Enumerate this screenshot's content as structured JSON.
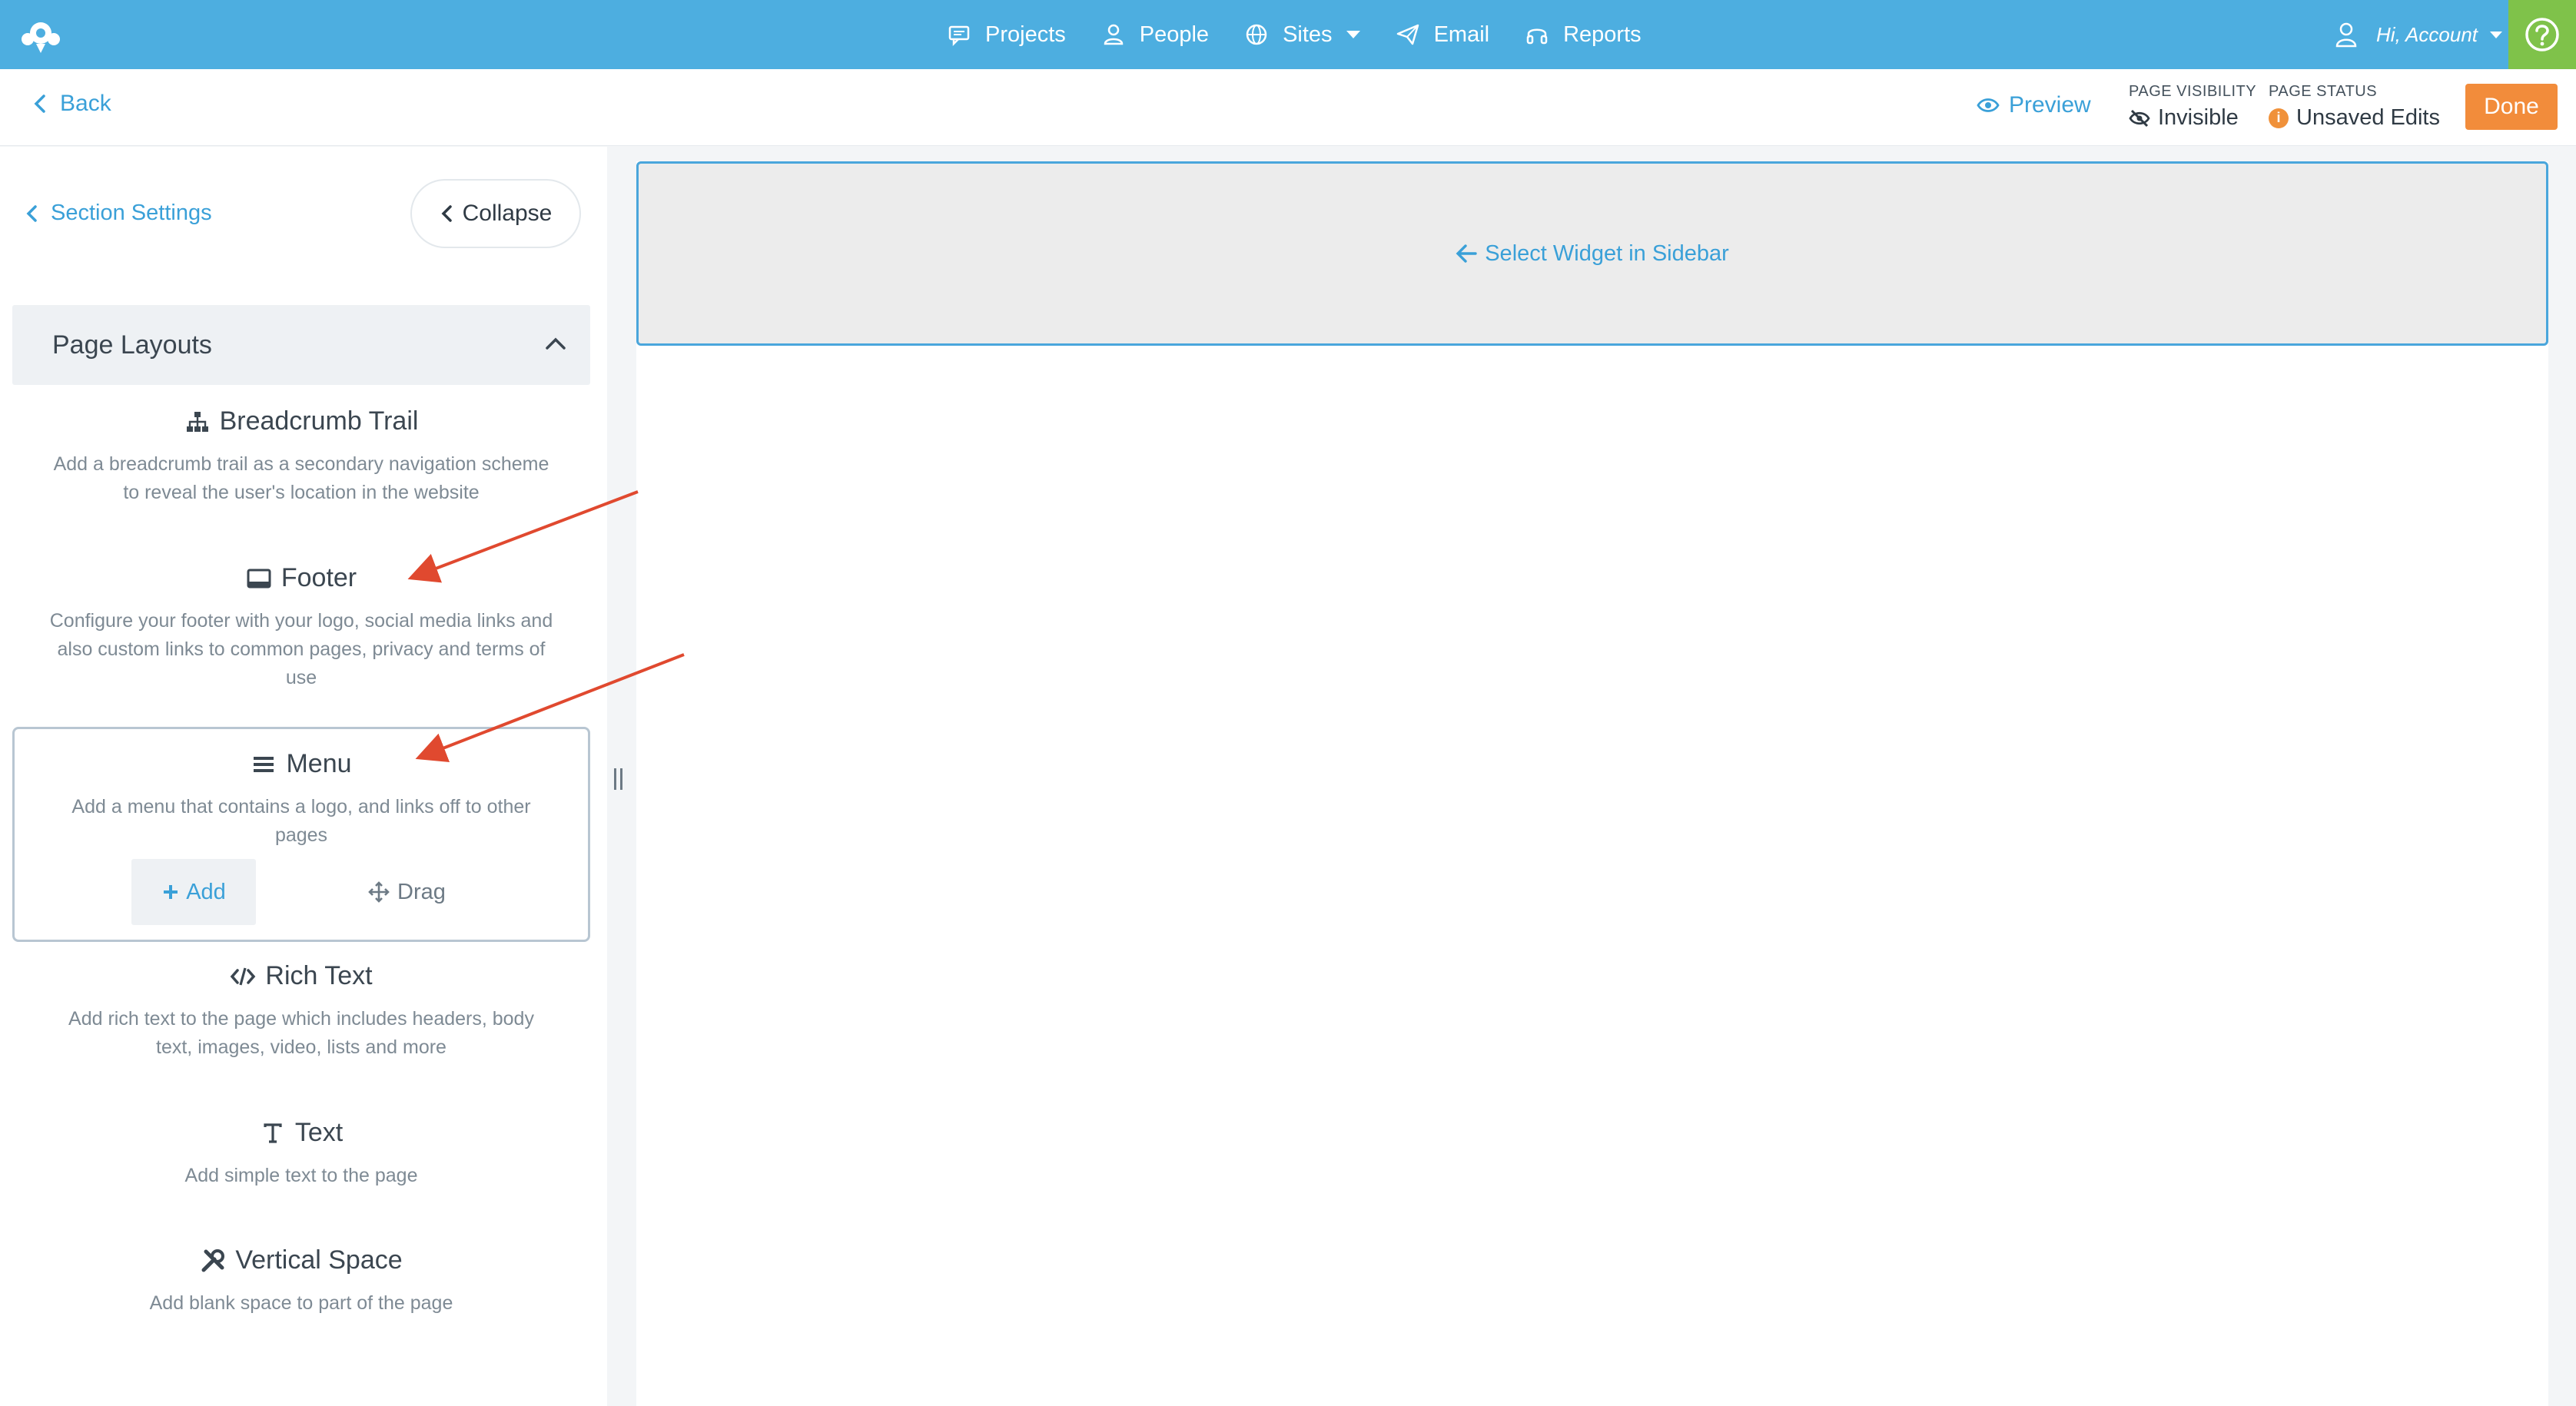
{
  "nav": {
    "items": [
      {
        "label": "Projects",
        "icon": "chat-icon"
      },
      {
        "label": "People",
        "icon": "user-icon"
      },
      {
        "label": "Sites",
        "icon": "globe-icon"
      },
      {
        "label": "Email",
        "icon": "paper-plane-icon"
      },
      {
        "label": "Reports",
        "icon": "headset-icon"
      }
    ],
    "account": "Hi, Account"
  },
  "subheader": {
    "back": "Back",
    "preview": "Preview",
    "visibility_label": "PAGE VISIBILITY",
    "visibility_value": "Invisible",
    "status_label": "PAGE STATUS",
    "status_value": "Unsaved Edits",
    "done": "Done"
  },
  "sidebar": {
    "section_settings": "Section Settings",
    "collapse": "Collapse",
    "group_title": "Page Layouts",
    "widgets": [
      {
        "title": "Breadcrumb Trail",
        "icon": "sitemap-icon",
        "description": "Add a breadcrumb trail as a secondary navigation scheme to reveal the user's location in the website"
      },
      {
        "title": "Footer",
        "icon": "footer-icon",
        "description": "Configure your footer with your logo, social media links and also custom links to common pages, privacy and terms of use"
      },
      {
        "title": "Menu",
        "icon": "menu-icon",
        "description": "Add a menu that contains a logo, and links off to other pages",
        "add": "Add",
        "drag": "Drag"
      },
      {
        "title": "Rich Text",
        "icon": "code-icon",
        "description": "Add rich text to the page which includes headers, body text, images, video, lists and more"
      },
      {
        "title": "Text",
        "icon": "text-icon",
        "description": "Add simple text to the page"
      },
      {
        "title": "Vertical Space",
        "icon": "tools-icon",
        "description": "Add blank space to part of the page"
      }
    ]
  },
  "canvas": {
    "placeholder": "Select Widget in Sidebar"
  },
  "colors": {
    "brand": "#4daee0",
    "accent_link": "#3aa0d8",
    "done": "#f28c3b",
    "help": "#7fc24a",
    "annotation_arrow": "#e0492f"
  }
}
